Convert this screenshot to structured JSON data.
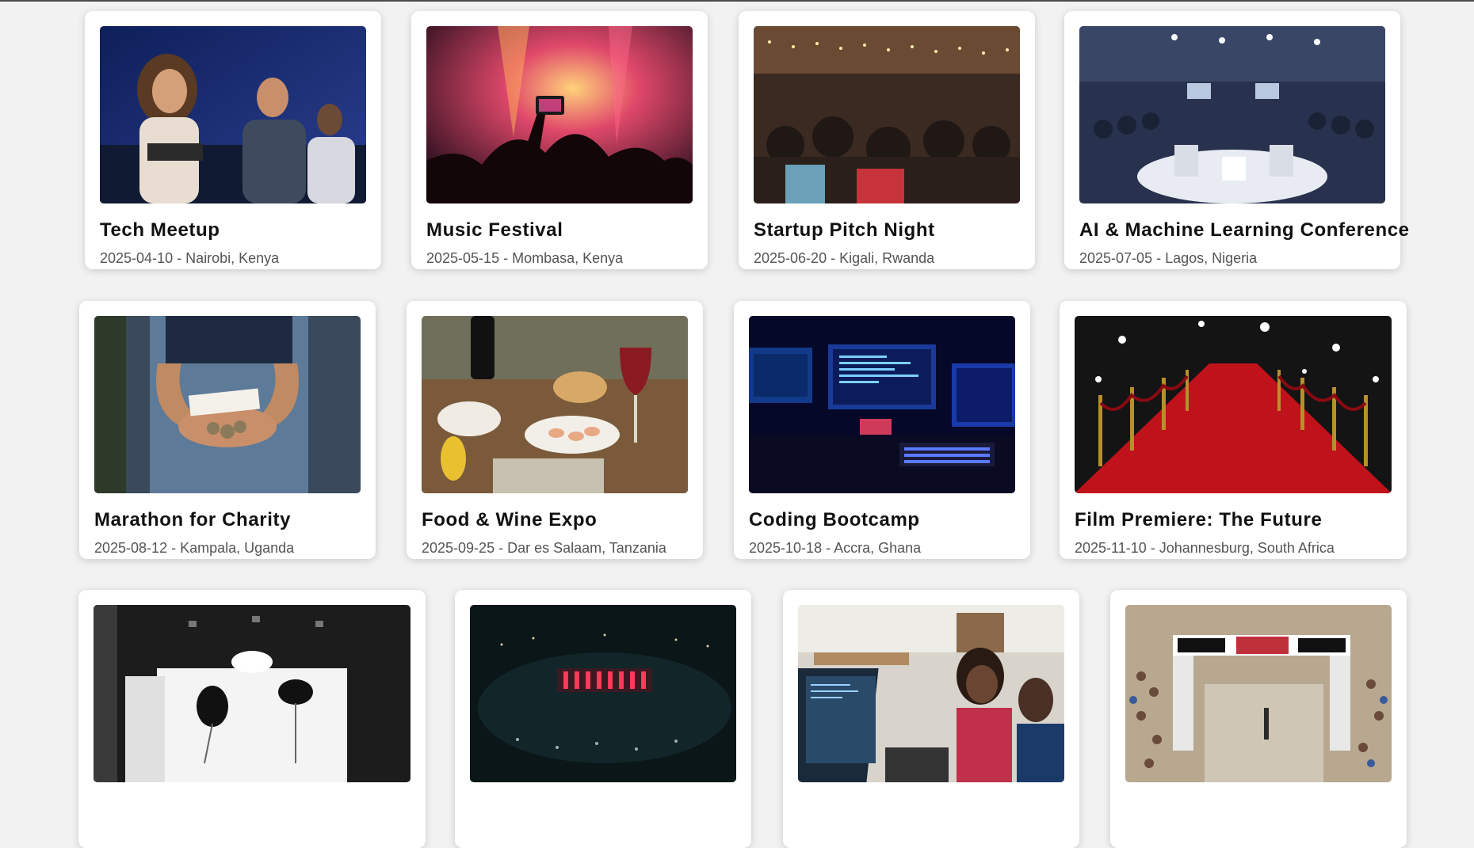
{
  "events": [
    {
      "title": "Tech Meetup",
      "date": "2025-04-10",
      "location": "Nairobi, Kenya",
      "image": "tech-meetup-photo"
    },
    {
      "title": "Music Festival",
      "date": "2025-05-15",
      "location": "Mombasa, Kenya",
      "image": "music-festival-photo"
    },
    {
      "title": "Startup Pitch Night",
      "date": "2025-06-20",
      "location": "Kigali, Rwanda",
      "image": "startup-pitch-photo"
    },
    {
      "title": "AI & Machine Learning Conference",
      "date": "2025-07-05",
      "location": "Lagos, Nigeria",
      "image": "ai-conference-photo"
    },
    {
      "title": "Marathon for Charity",
      "date": "2025-08-12",
      "location": "Kampala, Uganda",
      "image": "charity-hands-photo"
    },
    {
      "title": "Food & Wine Expo",
      "date": "2025-09-25",
      "location": "Dar es Salaam, Tanzania",
      "image": "food-wine-photo"
    },
    {
      "title": "Coding Bootcamp",
      "date": "2025-10-18",
      "location": "Accra, Ghana",
      "image": "coding-setup-photo"
    },
    {
      "title": "Film Premiere: The Future",
      "date": "2025-11-10",
      "location": "Johannesburg, South Africa",
      "image": "red-carpet-photo"
    },
    {
      "title": "",
      "date": "",
      "location": "",
      "image": "photo-studio-photo"
    },
    {
      "title": "",
      "date": "",
      "location": "",
      "image": "concert-arena-photo"
    },
    {
      "title": "",
      "date": "",
      "location": "",
      "image": "office-team-photo"
    },
    {
      "title": "",
      "date": "",
      "location": "",
      "image": "marathon-finish-photo"
    }
  ],
  "separator": " - ",
  "colors": {
    "background": "#f2f2f2",
    "card": "#ffffff",
    "title": "#111111",
    "meta": "#555555"
  }
}
